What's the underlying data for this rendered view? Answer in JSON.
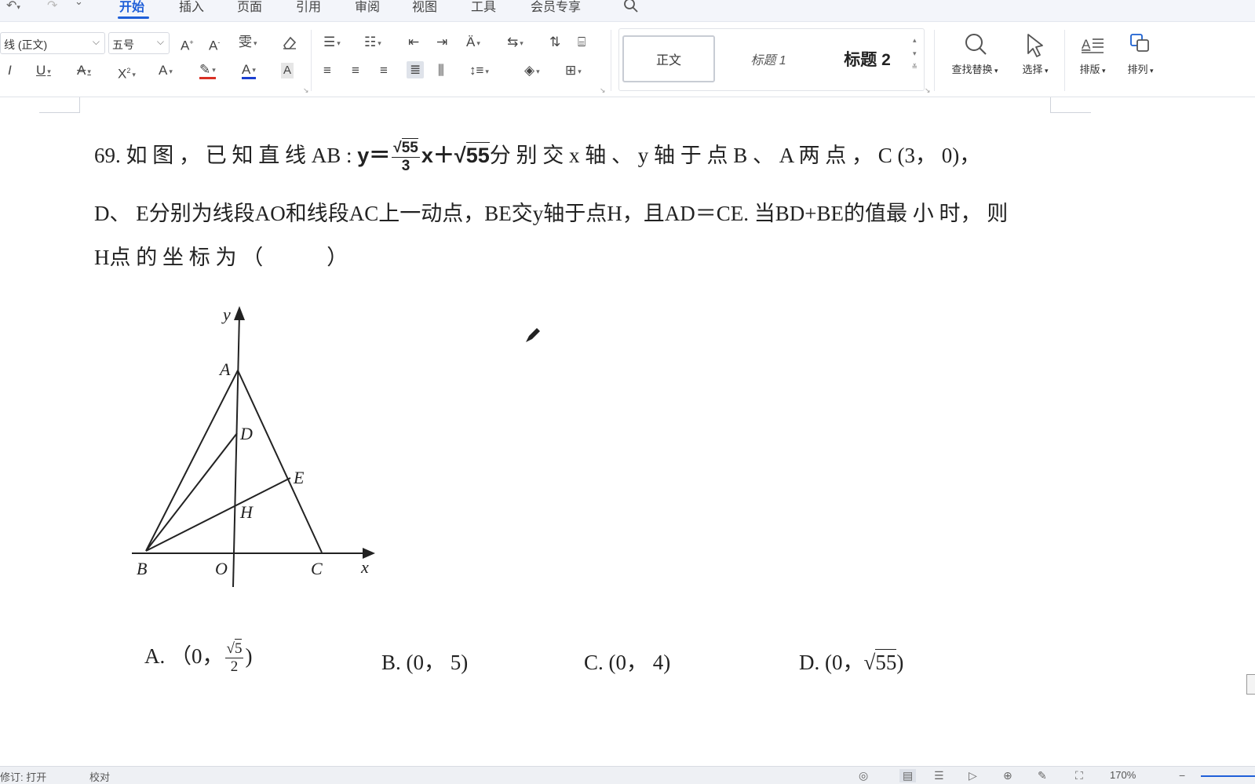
{
  "toolbar": {
    "undo_icon": "undo-icon",
    "redo_icon": "redo-icon",
    "tabs": [
      {
        "label": "开始",
        "active": true
      },
      {
        "label": "插入"
      },
      {
        "label": "页面"
      },
      {
        "label": "引用"
      },
      {
        "label": "审阅"
      },
      {
        "label": "视图"
      },
      {
        "label": "工具"
      },
      {
        "label": "会员专享"
      }
    ]
  },
  "ribbon": {
    "font_name": "线 (正文)",
    "font_size": "五号",
    "styles": {
      "normal": "正文",
      "heading1": "标题 1",
      "heading2": "标题 2"
    },
    "find_replace": "查找替换",
    "select": "选择",
    "layout": "排版",
    "arrange": "排列"
  },
  "question": {
    "l1_a": "69. 如 图 ， 已 知 直 线 AB : ",
    "eq_y": "y＝",
    "frac_num": "55",
    "frac_den": "3",
    "eq_x": "x＋",
    "eq_rad": "55",
    "l1_b": "分 别 交 x 轴 、 y 轴 于 点 B 、 A 两 点 ， C (3， 0)，",
    "line2": "D、  E分别为线段AO和线段AC上一动点，BE交y轴于点H，且AD＝CE. 当BD+BE的值最 小 时， 则",
    "line3": "H点 的 坐 标 为 （　　　）"
  },
  "figure": {
    "label_y": "y",
    "label_x": "x",
    "label_A": "A",
    "label_D": "D",
    "label_E": "E",
    "label_H": "H",
    "label_B": "B",
    "label_O": "O",
    "label_C": "C"
  },
  "choices": {
    "a_pre": "A. （0，",
    "a_num": "5",
    "a_den": "2",
    "a_post": ")",
    "b": "B. (0， 5)",
    "c": "C. (0， 4)",
    "d_pre": "D. (0，",
    "d_rad": "55",
    "d_post": ")"
  },
  "status": {
    "left1": "修订: 打开",
    "left2": "校对",
    "zoom": "170%"
  },
  "colors": {
    "accent": "#1f5fd8",
    "highlight_red": "#d93025",
    "font_blue": "#1a3fd0"
  }
}
